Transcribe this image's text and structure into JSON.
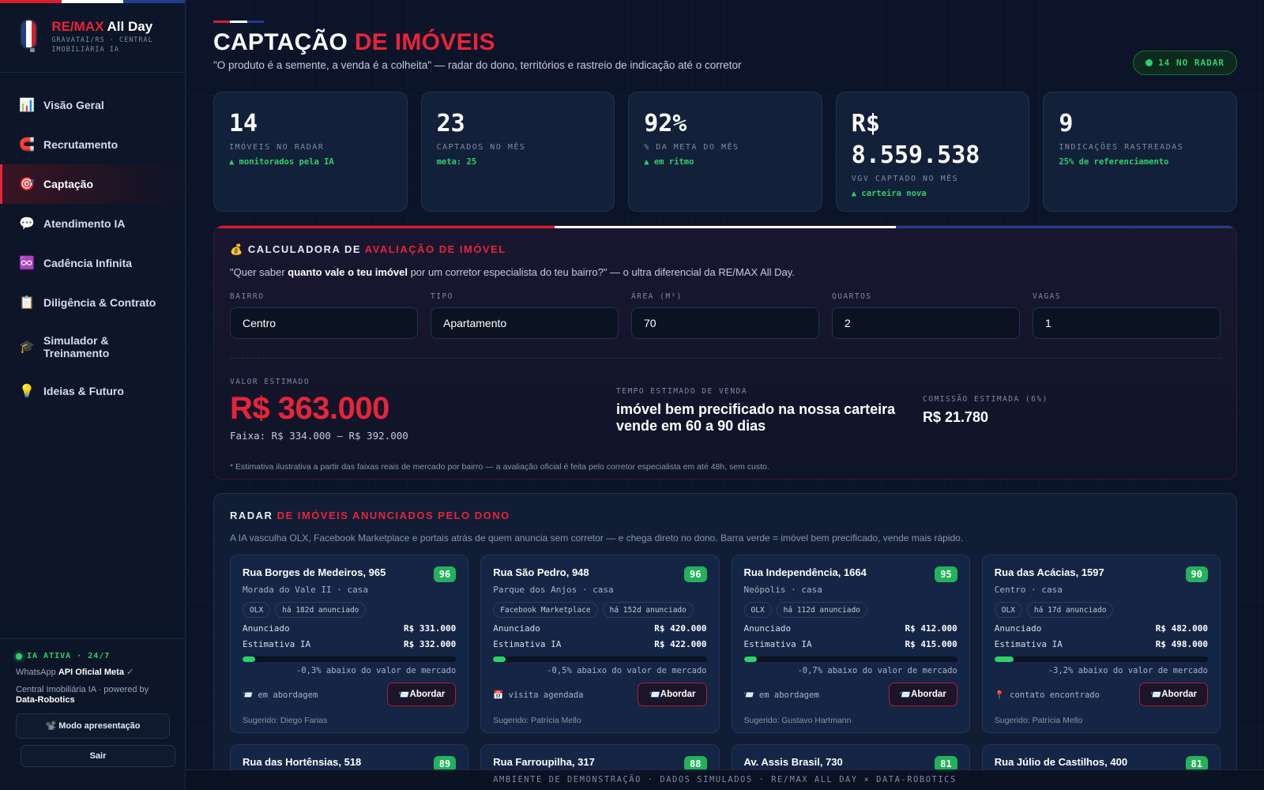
{
  "brand": {
    "name_red": "RE/MAX",
    "name_white": "All Day",
    "sub": "GRAVATAÍ/RS · CENTRAL IMOBILIÁRIA IA",
    "colors": {
      "red": "#dc1c2e",
      "white": "#ffffff",
      "blue": "#1f3e8c"
    }
  },
  "nav": [
    {
      "label": "Visão Geral",
      "icon": "📊",
      "icon_name": "bar-chart-icon"
    },
    {
      "label": "Recrutamento",
      "icon": "🧲",
      "icon_name": "magnet-icon"
    },
    {
      "label": "Captação",
      "icon": "🎯",
      "icon_name": "target-icon",
      "active": true
    },
    {
      "label": "Atendimento IA",
      "icon": "💬",
      "icon_name": "chat-icon"
    },
    {
      "label": "Cadência Infinita",
      "icon": "♾️",
      "icon_name": "infinity-icon"
    },
    {
      "label": "Diligência & Contrato",
      "icon": "📋",
      "icon_name": "clipboard-icon"
    },
    {
      "label": "Simulador & Treinamento",
      "icon": "🎓",
      "icon_name": "graduation-cap-icon"
    },
    {
      "label": "Ideias & Futuro",
      "icon": "💡",
      "icon_name": "lightbulb-icon"
    }
  ],
  "sidebar_footer": {
    "status": "IA ATIVA · 24/7",
    "whatsapp_pre": "WhatsApp ",
    "whatsapp_bold": "API Oficial Meta",
    "whatsapp_check": " ✓",
    "powered_pre": "Central Imobiliária IA · powered by ",
    "powered_bold": "Data-Robotics",
    "present_icon": "📽️",
    "present_label": "Modo apresentação",
    "logout_label": "Sair"
  },
  "header": {
    "title_white": "CAPTAÇÃO",
    "title_red": "DE IMÓVEIS",
    "subtitle": "\"O produto é a semente, a venda é a colheita\" — radar do dono, territórios e rastreio de indicação até o corretor",
    "badge": "14 NO RADAR"
  },
  "kpis": [
    {
      "value": "14",
      "label": "IMÓVEIS NO RADAR",
      "note": "▲ monitorados pela IA"
    },
    {
      "value": "23",
      "label": "CAPTADOS NO MÊS",
      "note": "meta: 25"
    },
    {
      "value": "92%",
      "label": "% DA META DO MÊS",
      "note": "▲ em ritmo"
    },
    {
      "value": "R$ 8.559.538",
      "label": "VGV CAPTADO NO MÊS",
      "note": "▲ carteira nova"
    },
    {
      "value": "9",
      "label": "INDICAÇÕES RASTREADAS",
      "note": "25% de referenciamento"
    }
  ],
  "calculator": {
    "icon": "💰",
    "title_white": "CALCULADORA DE",
    "title_red": "AVALIAÇÃO DE IMÓVEL",
    "lead_1": "\"Quer saber ",
    "lead_bold": "quanto vale o teu imóvel",
    "lead_2": " por um corretor especialista do teu bairro?\" — o ultra diferencial da RE/MAX All Day.",
    "fields": [
      {
        "label": "BAIRRO",
        "value": "Centro"
      },
      {
        "label": "TIPO",
        "value": "Apartamento"
      },
      {
        "label": "ÁREA (M²)",
        "value": "70"
      },
      {
        "label": "QUARTOS",
        "value": "2"
      },
      {
        "label": "VAGAS",
        "value": "1"
      }
    ],
    "estimate_label": "VALOR ESTIMADO",
    "estimate_value": "R$ 363.000",
    "range": "Faixa: R$ 334.000 — R$ 392.000",
    "time_label": "TEMPO ESTIMADO DE VENDA",
    "time_value": "imóvel bem precificado na nossa carteira vende em 60 a 90 dias",
    "commission_label": "COMISSÃO ESTIMADA (6%)",
    "commission_value": "R$ 21.780",
    "note": "* Estimativa ilustrativa a partir das faixas reais de mercado por bairro — a avaliação oficial é feita pelo corretor especialista em até 48h, sem custo."
  },
  "radar": {
    "title_white": "RADAR",
    "title_red": "DE IMÓVEIS ANUNCIADOS PELO DONO",
    "lead": "A IA vasculha OLX, Facebook Marketplace e portais atrás de quem anuncia sem corretor — e chega direto no dono. Barra verde = imóvel bem precificado, vende mais rápido.",
    "listed_label": "Anunciado",
    "estimate_label": "Estimativa IA",
    "button_icon": "📨",
    "button_label": "Abordar",
    "cards": [
      {
        "address": "Rua Borges de Medeiros, 965",
        "score": "96",
        "location": "Morada do Vale II · casa",
        "tags": [
          "OLX",
          "há 182d anunciado"
        ],
        "listed": "R$ 331.000",
        "estimate": "R$ 332.000",
        "bar": 0.06,
        "pct_text": "-0,3% abaixo do valor de mercado",
        "status_icon": "📨",
        "status": "em abordagem",
        "suggested": "Sugerido: Diego Farias"
      },
      {
        "address": "Rua São Pedro, 948",
        "score": "96",
        "location": "Parque dos Anjos · casa",
        "tags": [
          "Facebook Marketplace",
          "há 152d anunciado"
        ],
        "listed": "R$ 420.000",
        "estimate": "R$ 422.000",
        "bar": 0.06,
        "pct_text": "-0,5% abaixo do valor de mercado",
        "status_icon": "📅",
        "status": "visita agendada",
        "suggested": "Sugerido: Patrícia Mello"
      },
      {
        "address": "Rua Independência, 1664",
        "score": "95",
        "location": "Neópolis · casa",
        "tags": [
          "OLX",
          "há 112d anunciado"
        ],
        "listed": "R$ 412.000",
        "estimate": "R$ 415.000",
        "bar": 0.06,
        "pct_text": "-0,7% abaixo do valor de mercado",
        "status_icon": "📨",
        "status": "em abordagem",
        "suggested": "Sugerido: Gustavo Hartmann"
      },
      {
        "address": "Rua das Acácias, 1597",
        "score": "90",
        "location": "Centro · casa",
        "tags": [
          "OLX",
          "há 17d anunciado"
        ],
        "listed": "R$ 482.000",
        "estimate": "R$ 498.000",
        "bar": 0.09,
        "pct_text": "-3,2% abaixo do valor de mercado",
        "status_icon": "📍",
        "status": "contato encontrado",
        "suggested": "Sugerido: Patrícia Mello"
      }
    ],
    "cards_next": [
      {
        "address": "Rua das Hortênsias, 518",
        "score": "89"
      },
      {
        "address": "Rua Farroupilha, 317",
        "score": "88"
      },
      {
        "address": "Av. Assis Brasil, 730",
        "score": "81"
      },
      {
        "address": "Rua Júlio de Castilhos, 400",
        "score": "81"
      }
    ]
  },
  "footer_banner": "AMBIENTE DE DEMONSTRAÇÃO · DADOS SIMULADOS · RE/MAX ALL DAY × DATA-ROBOTICS"
}
